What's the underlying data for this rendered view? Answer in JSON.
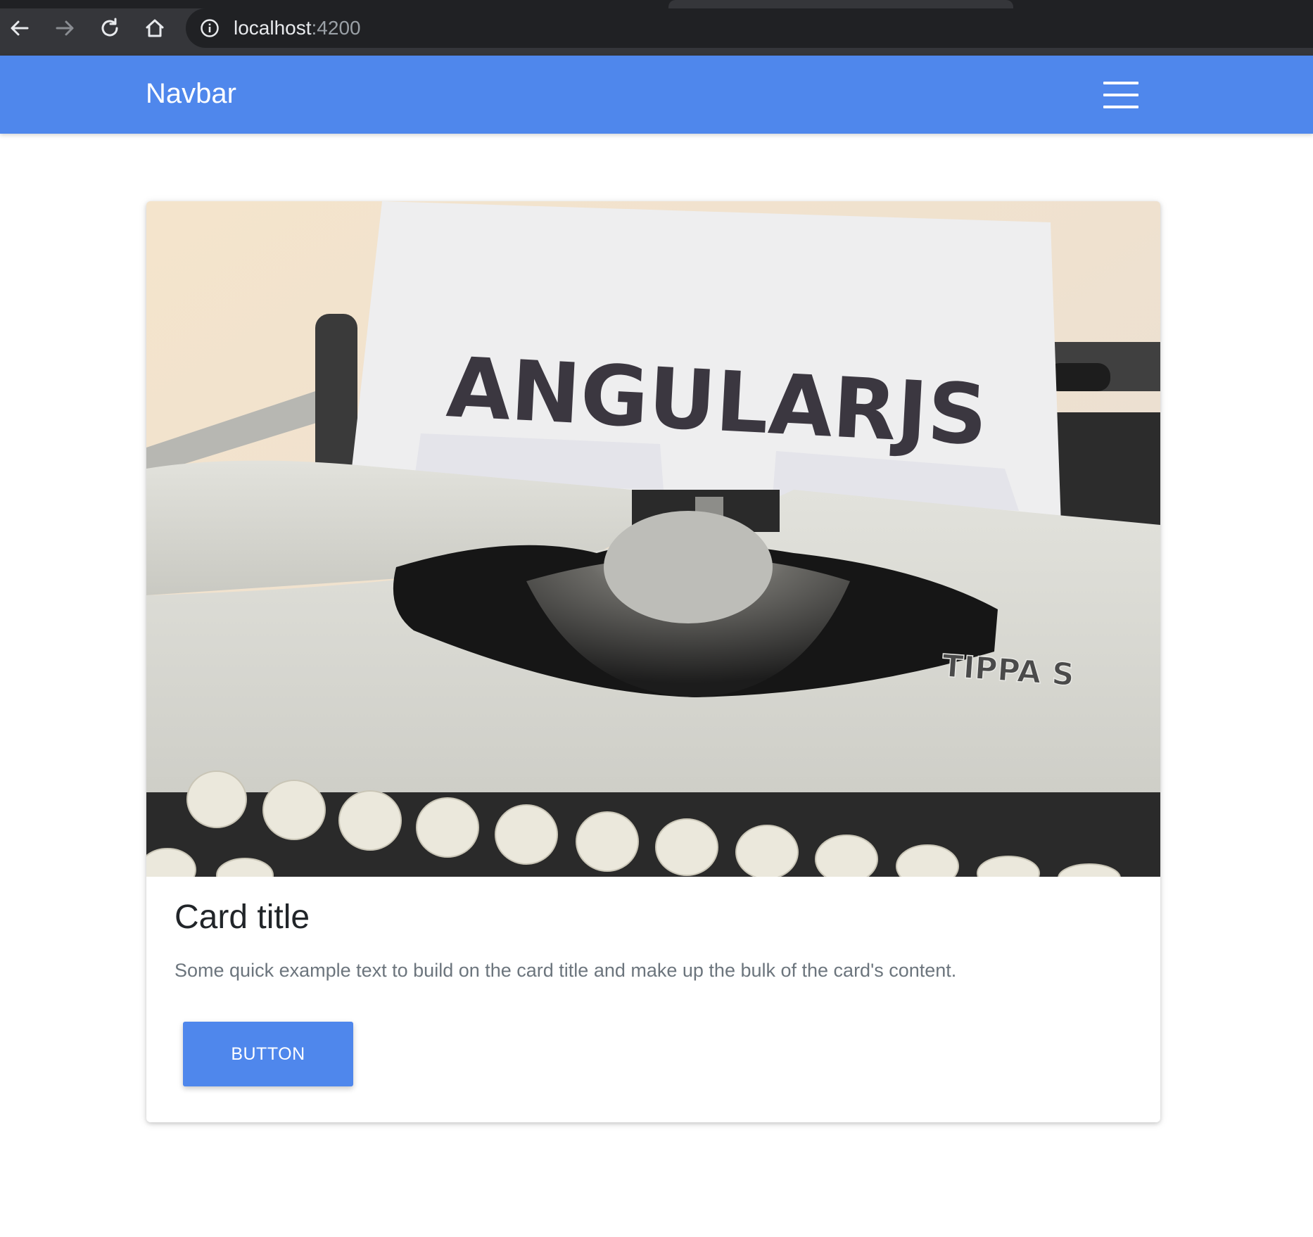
{
  "browser": {
    "url_host": "localhost",
    "url_port": ":4200",
    "icons": [
      "back-arrow-icon",
      "forward-arrow-icon",
      "reload-icon",
      "home-icon",
      "site-info-icon"
    ]
  },
  "navbar": {
    "brand": "Navbar",
    "toggler_icon": "hamburger-menu-icon",
    "color": "#4f87ec"
  },
  "card": {
    "image": {
      "typed_text": "ANGULARJS",
      "brand_plate": "TIPPA S"
    },
    "title": "Card title",
    "text": "Some quick example text to build on the card title and make up the bulk of the card's content.",
    "button_label": "BUTTON"
  }
}
